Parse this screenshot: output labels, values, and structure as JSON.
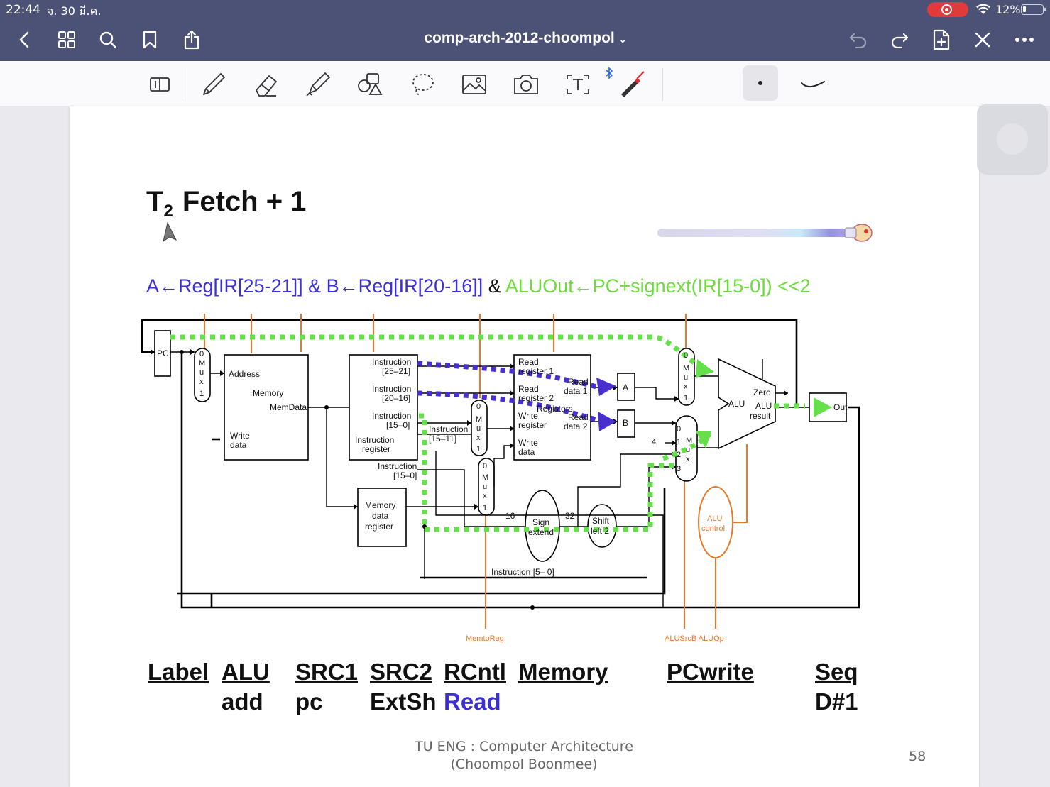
{
  "status_bar": {
    "time": "22:44",
    "date": "จ. 30 มี.ค.",
    "battery": "12%"
  },
  "nav": {
    "document_title": "comp-arch-2012-choompol"
  },
  "slide": {
    "title_main": "T",
    "title_sub": "2",
    "title_rest": " Fetch + 1",
    "formula_blue": "A←Reg[IR[25-21]] & B←Reg[IR[20-16]]",
    "formula_black": " & ",
    "formula_green": "ALUOut←PC+signext(IR[15-0]) <<2",
    "diagram": {
      "pc": "PC",
      "mux": "M",
      "mux_u": "u",
      "mux_x": "x",
      "zero": "0",
      "one": "1",
      "two": "2",
      "three": "3",
      "four": "4",
      "address": "Address",
      "memory": "Memory",
      "memdata": "MemData",
      "write": "Write",
      "data": "data",
      "instr": "Instruction",
      "i_25_21": "[25–21]",
      "i_20_16": "[20–16]",
      "i_15_0": "[15–0]",
      "i_15_11": "[15–11]",
      "i_15_0b": "[15–0]",
      "instr_register": "Instruction",
      "register": "register",
      "mdr_memory": "Memory",
      "mdr_data": "data",
      "mdr_register": "register",
      "read": "Read",
      "register_1": "register 1",
      "register_2": "register 2",
      "registers": "Registers",
      "write_register": "register",
      "read_data_1": "data 1",
      "read_data_2": "data 2",
      "write_data": "data",
      "a": "A",
      "b": "B",
      "alu": "ALU",
      "zero_label": "Zero",
      "alu_result_1": "ALU",
      "alu_result_2": "result",
      "aluout": "Out",
      "sign": "Sign",
      "extend": "extend",
      "shift": "Shift",
      "left2": "left 2",
      "n16": "16",
      "n32": "32",
      "alu_control_1": "ALU",
      "alu_control_2": "control",
      "instr_5_0": "Instruction [5– 0]",
      "memtoreg": "MemtoReg",
      "alusrcb_aluop": "ALUSrcB ALUOp"
    },
    "table": {
      "headers": [
        "Label",
        "ALU",
        "SRC1",
        "SRC2",
        "RCntl",
        "Memory",
        "PCwrite",
        "Seq"
      ],
      "values": {
        "alu": "add",
        "src1": "pc",
        "src2": "ExtSh",
        "rcntl": "Read",
        "seq": "D#1"
      }
    },
    "footer_line1": "TU ENG : Computer Architecture",
    "footer_line2": "(Choompol Boonmee)",
    "page_number": "58"
  },
  "colors": {
    "navbar": "#4b5275",
    "formula_blue": "#3b2fd6",
    "formula_green": "#6bdc3a",
    "control_orange": "#e8782a",
    "path_green": "#66e04a",
    "path_purple": "#4a2fd0"
  },
  "icons": [
    "back-icon",
    "grid-icon",
    "search-icon",
    "bookmark-icon",
    "share-icon",
    "undo-icon",
    "redo-icon",
    "add-page-icon",
    "close-icon",
    "more-icon",
    "read-mode-icon",
    "pen-icon",
    "eraser-icon",
    "highlighter-icon",
    "shapes-icon",
    "lasso-icon",
    "image-icon",
    "camera-icon",
    "textbox-icon",
    "laser-pointer-icon",
    "bluetooth-icon"
  ]
}
